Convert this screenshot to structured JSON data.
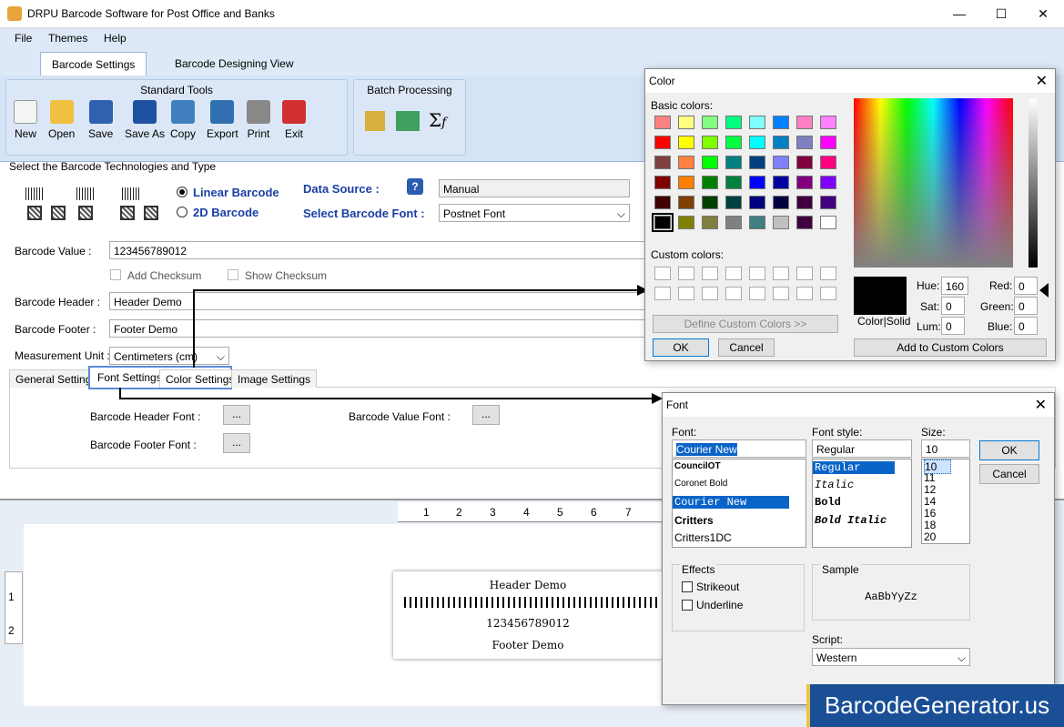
{
  "window": {
    "title": "DRPU Barcode Software for Post Office and Banks",
    "minimize": "—",
    "maximize": "☐",
    "close": "✕"
  },
  "menu": [
    "File",
    "Themes",
    "Help"
  ],
  "tabs": [
    "Barcode Settings",
    "Barcode Designing View"
  ],
  "ribbon": {
    "standard_title": "Standard Tools",
    "standard_tools": [
      "New",
      "Open",
      "Save",
      "Save As",
      "Copy",
      "Export",
      "Print",
      "Exit"
    ],
    "batch_title": "Batch Processing"
  },
  "tech": {
    "section_title": "Select the Barcode Technologies and Type",
    "linear": "Linear Barcode",
    "twod": "2D Barcode",
    "data_source_label": "Data Source :",
    "data_source_value": "Manual",
    "font_label": "Select Barcode Font :",
    "font_value": "Postnet Font"
  },
  "fields": {
    "value_label": "Barcode Value :",
    "value": "123456789012",
    "add_checksum": "Add Checksum",
    "show_checksum": "Show Checksum",
    "header_label": "Barcode Header :",
    "header": "Header Demo",
    "footer_label": "Barcode Footer :",
    "footer": "Footer Demo",
    "unit_label": "Measurement Unit :",
    "unit": "Centimeters (cm)"
  },
  "subtabs": [
    "General Settings",
    "Font Settings",
    "Color Settings",
    "Image Settings"
  ],
  "fontsettings": {
    "header_font": "Barcode Header Font :",
    "value_font": "Barcode Value Font :",
    "footer_font": "Barcode Footer Font :",
    "dots": "..."
  },
  "ruler": [
    "1",
    "2",
    "3",
    "4",
    "5",
    "6",
    "7"
  ],
  "vruler": [
    "1",
    "2"
  ],
  "preview": {
    "header": "Header Demo",
    "value": "123456789012",
    "footer": "Footer Demo"
  },
  "color_dialog": {
    "title": "Color",
    "basic": "Basic colors:",
    "custom": "Custom colors:",
    "define": "Define Custom Colors >>",
    "ok": "OK",
    "cancel": "Cancel",
    "colorsolid": "Color|Solid",
    "hue_l": "Hue:",
    "hue": "160",
    "sat_l": "Sat:",
    "sat": "0",
    "lum_l": "Lum:",
    "lum": "0",
    "red_l": "Red:",
    "red": "0",
    "green_l": "Green:",
    "green": "0",
    "blue_l": "Blue:",
    "blue": "0",
    "add": "Add to Custom Colors",
    "swatches": [
      "#ff8080",
      "#ffff80",
      "#80ff80",
      "#00ff80",
      "#80ffff",
      "#0080ff",
      "#ff80c0",
      "#ff80ff",
      "#ff0000",
      "#ffff00",
      "#80ff00",
      "#00ff40",
      "#00ffff",
      "#0080c0",
      "#8080c0",
      "#ff00ff",
      "#804040",
      "#ff8040",
      "#00ff00",
      "#008080",
      "#004080",
      "#8080ff",
      "#800040",
      "#ff0080",
      "#800000",
      "#ff8000",
      "#008000",
      "#008040",
      "#0000ff",
      "#0000a0",
      "#800080",
      "#8000ff",
      "#400000",
      "#804000",
      "#004000",
      "#004040",
      "#000080",
      "#000040",
      "#400040",
      "#400080",
      "#000000",
      "#808000",
      "#808040",
      "#808080",
      "#408080",
      "#c0c0c0",
      "#400040",
      "#ffffff"
    ]
  },
  "font_dialog": {
    "title": "Font",
    "font_l": "Font:",
    "font": "Courier New",
    "style_l": "Font style:",
    "style": "Regular",
    "size_l": "Size:",
    "size": "10",
    "fonts": [
      "CouncilOT",
      "Coronet Bold",
      "Courier New",
      "Critters",
      "Critters1DC"
    ],
    "styles": [
      "Regular",
      "Italic",
      "Bold",
      "Bold Italic"
    ],
    "sizes": [
      "10",
      "11",
      "12",
      "14",
      "16",
      "18",
      "20"
    ],
    "ok": "OK",
    "cancel": "Cancel",
    "effects": "Effects",
    "strikeout": "Strikeout",
    "underline": "Underline",
    "sample_l": "Sample",
    "sample": "AaBbYyZz",
    "script_l": "Script:",
    "script": "Western"
  },
  "watermark": "BarcodeGenerator.us"
}
